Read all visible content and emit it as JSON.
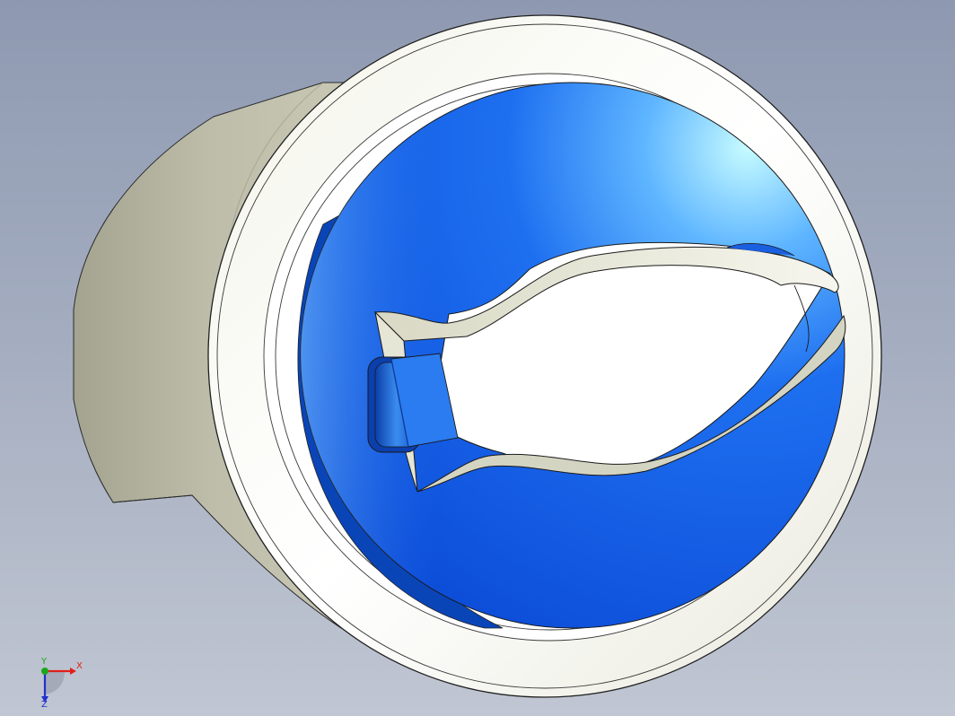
{
  "viewport": {
    "background_top": "#8e99b1",
    "background_bottom": "#c0c6d2"
  },
  "model": {
    "body_color": "#b9b9a5",
    "rim_color": "#ffffff",
    "disc_color": "#1256e0",
    "disc_highlight": "#b9f6ff",
    "clip_color": "#ffffff"
  },
  "triad": {
    "x_label": "X",
    "y_label": "Y",
    "z_label": "Z",
    "x_color": "#e0201a",
    "y_color": "#1aa81a",
    "z_color": "#2030d0"
  }
}
